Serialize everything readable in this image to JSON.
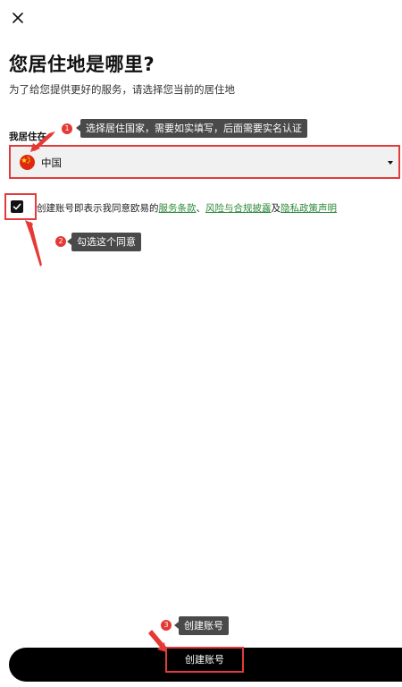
{
  "header": {
    "close_icon": "close-icon"
  },
  "page": {
    "title": "您居住地是哪里?",
    "subtitle": "为了给您提供更好的服务，请选择您当前的居住地"
  },
  "residence": {
    "label": "我居住在",
    "selected_country": "中国",
    "flag_icon": "china-flag-icon",
    "dropdown_icon": "caret-down-icon"
  },
  "agreement": {
    "checked": true,
    "prefix": "创建账号即表示我同意欧易的",
    "link_terms": "服务条款",
    "separator": "、",
    "link_risk": "风险与合规披露",
    "conjunction": "及",
    "link_privacy": "隐私政策声明"
  },
  "footer": {
    "create_button_label": "创建账号"
  },
  "annotations": [
    {
      "number": "1",
      "text": "选择居住国家，需要如实填写，后面需要实名认证"
    },
    {
      "number": "2",
      "text": "勾选这个同意"
    },
    {
      "number": "3",
      "text": "创建账号"
    }
  ],
  "colors": {
    "accent_link": "#2f8a3a",
    "annotation_red": "#e53935",
    "tooltip_bg": "#4a4a4a",
    "button_bg": "#000000",
    "select_bg": "#f1f1f2"
  }
}
